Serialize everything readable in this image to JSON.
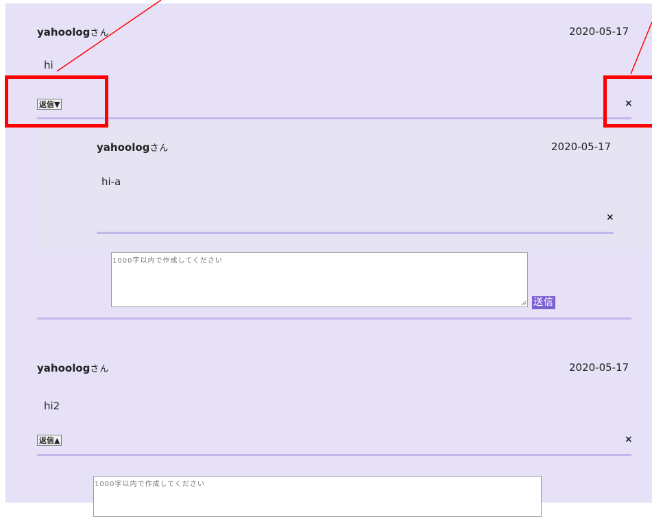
{
  "comments": [
    {
      "author": "yahoolog",
      "suffix": "さん",
      "date": "2020-05-17",
      "body": "hi",
      "reply_toggle": "返信▼",
      "delete": "×",
      "replies": [
        {
          "author": "yahoolog",
          "suffix": "さん",
          "date": "2020-05-17",
          "body": "hi-a",
          "delete": "×"
        }
      ],
      "reply_form": {
        "placeholder": "1000字以内で作成してください",
        "send_label": "送信"
      }
    },
    {
      "author": "yahoolog",
      "suffix": "さん",
      "date": "2020-05-17",
      "body": "hi2",
      "reply_toggle": "返信▲",
      "delete": "×",
      "reply_form": {
        "placeholder": "1000字以内で作成してください"
      }
    }
  ],
  "colors": {
    "panel_bg": "#e7e1f7",
    "divider": "#c3b6ec",
    "send_button": "#7c5fd3",
    "callout": "#ff0000"
  }
}
